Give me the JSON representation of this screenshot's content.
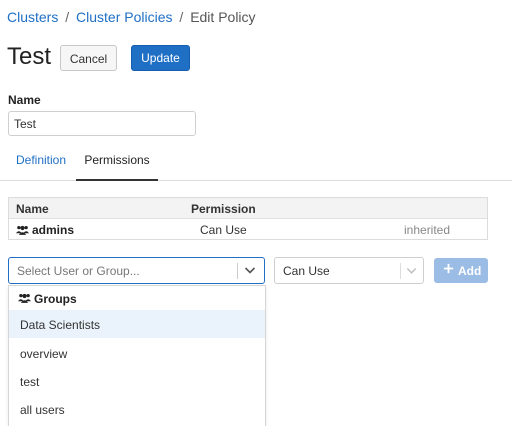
{
  "breadcrumb": {
    "clusters": "Clusters",
    "separator1": "/",
    "cluster_policies": "Cluster Policies",
    "separator2": "/",
    "current": "Edit Policy"
  },
  "page": {
    "title": "Test"
  },
  "actions": {
    "cancel_label": "Cancel",
    "update_label": "Update"
  },
  "name_field": {
    "label": "Name",
    "value": "Test"
  },
  "tabs": [
    {
      "label": "Definition",
      "active": false
    },
    {
      "label": "Permissions",
      "active": true
    }
  ],
  "permissions_table": {
    "columns": [
      "Name",
      "Permission"
    ],
    "rows": [
      {
        "name": "admins",
        "icon": "group-icon",
        "permission": "Can Use",
        "status": "inherited"
      }
    ]
  },
  "add_permission": {
    "user_select_placeholder": "Select User or Group...",
    "permission_value": "Can Use",
    "add_label": "Add"
  },
  "dropdown": {
    "group_header": "Groups",
    "options": [
      "Data Scientists",
      "overview",
      "test",
      "all users"
    ]
  },
  "colors": {
    "accent": "#1f6fc5",
    "add_button_disabled": "#9bbce4",
    "highlight": "#eaf2fb"
  }
}
